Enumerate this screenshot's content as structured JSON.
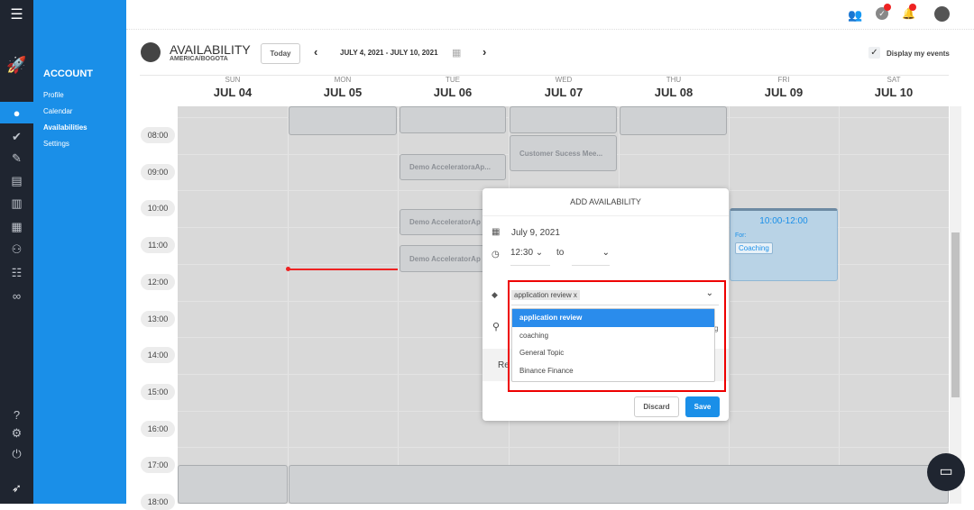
{
  "sidebar": {
    "section": "ACCOUNT",
    "items": [
      "Profile",
      "Calendar",
      "Availabilities",
      "Settings"
    ]
  },
  "header": {
    "title": "AVAILABILITY",
    "timezone": "AMERICA/BOGOTA",
    "today": "Today",
    "range": "JULY 4, 2021 - JULY 10, 2021",
    "display_events": "Display my events"
  },
  "days": [
    {
      "d": "SUN",
      "n": "JUL 04"
    },
    {
      "d": "MON",
      "n": "JUL 05"
    },
    {
      "d": "TUE",
      "n": "JUL 06"
    },
    {
      "d": "WED",
      "n": "JUL 07"
    },
    {
      "d": "THU",
      "n": "JUL 08"
    },
    {
      "d": "FRI",
      "n": "JUL 09"
    },
    {
      "d": "SAT",
      "n": "JUL 10"
    }
  ],
  "times": [
    "08:00",
    "09:00",
    "10:00",
    "11:00",
    "12:00",
    "13:00",
    "14:00",
    "15:00",
    "16:00",
    "17:00",
    "18:00"
  ],
  "events": {
    "demo1": "Demo AcceleratoraAp...",
    "demo2": "Demo AcceleratorAp",
    "demo3": "Demo AcceleratorAp",
    "customer": "Customer Sucess Mee...",
    "fri_time": "10:00-12:00",
    "fri_for": "For:",
    "fri_tag": "Coaching"
  },
  "popup": {
    "title": "ADD AVAILABILITY",
    "date": "July 9, 2021",
    "start": "12:30",
    "to": "to",
    "tag": "application review",
    "tag_remove": "x",
    "options": [
      "application review",
      "coaching",
      "General Topic",
      "Binance Finance"
    ],
    "partial_text": "Re",
    "partial_g": "g",
    "discard": "Discard",
    "save": "Save"
  }
}
